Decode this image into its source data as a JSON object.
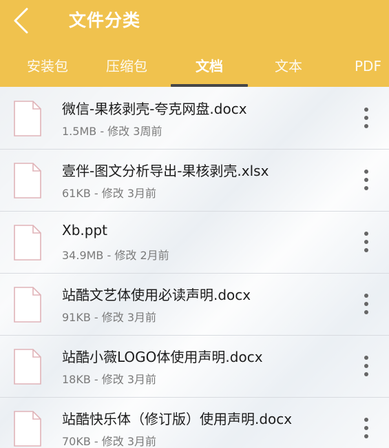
{
  "header": {
    "title": "文件分类",
    "back_icon": "chevron-left-icon"
  },
  "tabs": [
    {
      "label": "安装包"
    },
    {
      "label": "压缩包"
    },
    {
      "label": "文档"
    },
    {
      "label": "文本"
    },
    {
      "label": "PDF"
    }
  ],
  "active_tab": "文档",
  "files": [
    {
      "name": "微信-果核剥壳-夸克网盘.docx",
      "meta": "1.5MB - 修改 3周前"
    },
    {
      "name": "壹伴-图文分析导出-果核剥壳.xlsx",
      "meta": "61KB - 修改 3月前"
    },
    {
      "name": "Xb.ppt",
      "meta": "34.9MB - 修改 2月前"
    },
    {
      "name": "站酷文艺体使用必读声明.docx",
      "meta": "91KB - 修改 3月前"
    },
    {
      "name": "站酷小薇LOGO体使用声明.docx",
      "meta": "18KB - 修改 3月前"
    },
    {
      "name": "站酷快乐体（修订版）使用声明.docx",
      "meta": "70KB - 修改 3月前"
    }
  ],
  "colors": {
    "header_bg": "#f0c24e",
    "tab_indicator": "#474747",
    "file_icon_stroke": "#e0b3b8"
  }
}
